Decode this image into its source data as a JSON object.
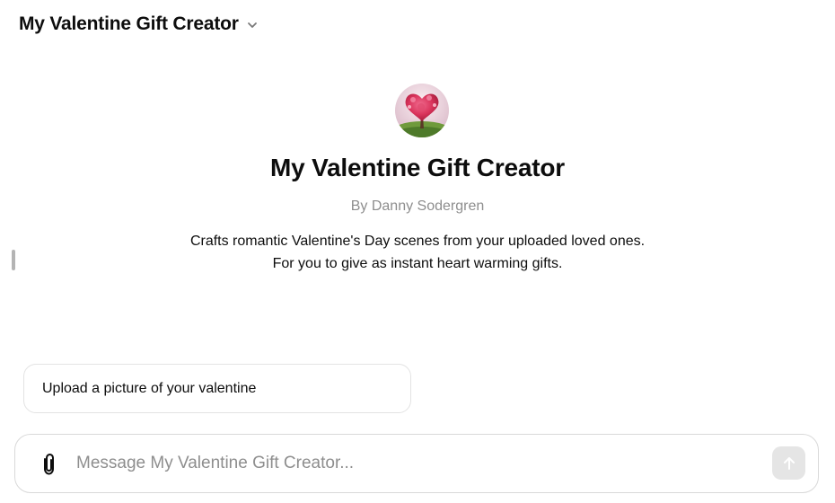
{
  "header": {
    "title": "My Valentine Gift Creator",
    "dropdown_icon": "chevron-down-icon"
  },
  "gpt": {
    "avatar_icon": "heart-tree-avatar",
    "name": "My Valentine Gift Creator",
    "author": "By Danny Sodergren",
    "description_lines": [
      "Crafts romantic Valentine's Day scenes from your uploaded loved ones.",
      "For you to give as instant heart warming gifts."
    ]
  },
  "conversation_starters": [
    {
      "label": "Upload a picture of your valentine"
    }
  ],
  "composer": {
    "attach_icon": "paperclip-icon",
    "placeholder": "Message My Valentine Gift Creator...",
    "value": "",
    "send_icon": "arrow-up-icon",
    "send_state": "disabled"
  },
  "colors": {
    "text_primary": "#0d0d0d",
    "text_secondary": "#8e8e8e",
    "border": "#e3e3e3",
    "send_disabled_bg": "#e5e5e5"
  }
}
